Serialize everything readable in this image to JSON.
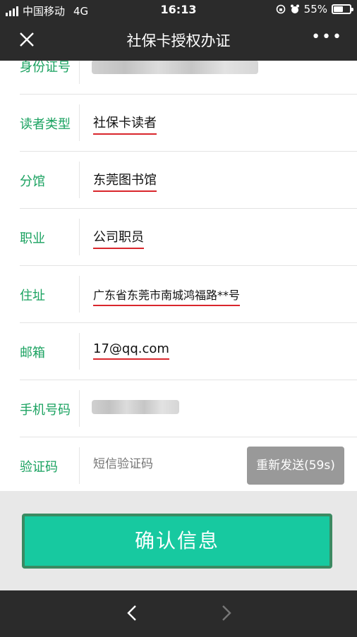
{
  "status_bar": {
    "carrier": "中国移动",
    "network": "4G",
    "time": "16:13",
    "battery": "55%"
  },
  "nav": {
    "title": "社保卡授权办证"
  },
  "form": {
    "id_label": "身份证号",
    "reader_type_label": "读者类型",
    "reader_type_value": "社保卡读者",
    "branch_label": "分馆",
    "branch_value": "东莞图书馆",
    "job_label": "职业",
    "job_value": "公司职员",
    "address_label": "住址",
    "address_value": "广东省东莞市南城鸿福路**号",
    "email_label": "邮箱",
    "email_value": "17@qq.com",
    "phone_label": "手机号码",
    "code_label": "验证码",
    "code_placeholder": "短信验证码",
    "resend_label": "重新发送(59s)"
  },
  "footer": {
    "confirm_label": "确认信息"
  },
  "colors": {
    "label_green": "#1aa260",
    "confirm_bg": "#17c9a0",
    "underline_red": "#d9262c",
    "bar_dark": "#2b2b2b"
  }
}
